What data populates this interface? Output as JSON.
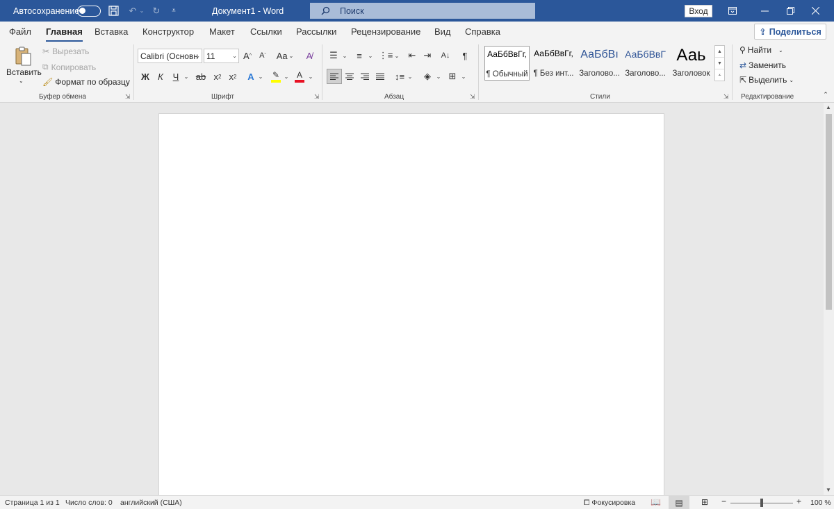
{
  "titlebar": {
    "autosave_label": "Автосохранение",
    "doc_title": "Документ1  -  Word",
    "search_placeholder": "Поиск",
    "signin_label": "Вход"
  },
  "tabs": [
    "Файл",
    "Главная",
    "Вставка",
    "Конструктор",
    "Макет",
    "Ссылки",
    "Рассылки",
    "Рецензирование",
    "Вид",
    "Справка"
  ],
  "active_tab": "Главная",
  "share_label": "Поделиться",
  "clipboard": {
    "paste": "Вставить",
    "cut": "Вырезать",
    "copy": "Копировать",
    "format_painter": "Формат по образцу",
    "group_label": "Буфер обмена"
  },
  "font": {
    "name": "Calibri (Основн",
    "size": "11",
    "group_label": "Шрифт",
    "bold": "Ж",
    "italic": "К",
    "underline": "Ч",
    "case_label": "Aa"
  },
  "paragraph": {
    "group_label": "Абзац"
  },
  "styles": {
    "items": [
      {
        "sample": "АаБбВвГг,",
        "name": "¶ Обычный"
      },
      {
        "sample": "АаБбВвГг,",
        "name": "¶ Без инт..."
      },
      {
        "sample": "АаБбВı",
        "name": "Заголово..."
      },
      {
        "sample": "АаБбВвГ",
        "name": "Заголово..."
      },
      {
        "sample": "Ааь",
        "name": "Заголовок"
      }
    ],
    "group_label": "Стили"
  },
  "editing": {
    "find": "Найти",
    "replace": "Заменить",
    "select": "Выделить",
    "group_label": "Редактирование"
  },
  "status": {
    "page": "Страница 1 из 1",
    "words": "Число слов: 0",
    "language": "английский (США)",
    "focus": "Фокусировка",
    "zoom": "100 %"
  },
  "colors": {
    "title_bar": "#2b579a",
    "highlight": "#ffff00",
    "font_color": "#e81123"
  }
}
